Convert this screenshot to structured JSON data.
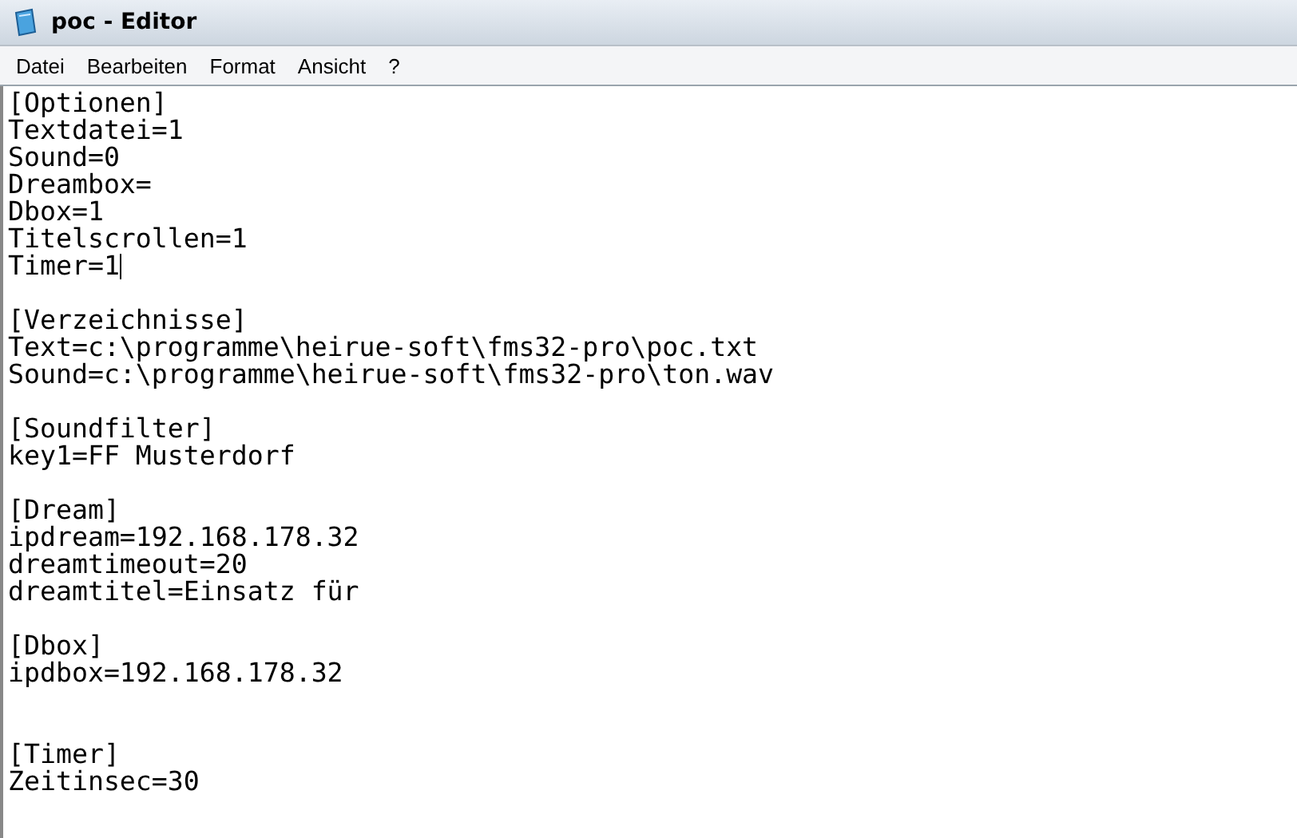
{
  "window": {
    "title": "poc - Editor"
  },
  "menu": [
    "Datei",
    "Bearbeiten",
    "Format",
    "Ansicht",
    "?"
  ],
  "lines": [
    {
      "kind": "text",
      "text": "[Optionen]",
      "caret": false
    },
    {
      "kind": "text",
      "text": "Textdatei=1",
      "caret": false
    },
    {
      "kind": "text",
      "text": "Sound=0",
      "caret": false
    },
    {
      "kind": "text",
      "text": "Dreambox=",
      "caret": false
    },
    {
      "kind": "text",
      "text": "Dbox=1",
      "caret": false
    },
    {
      "kind": "text",
      "text": "Titelscrollen=1",
      "caret": false
    },
    {
      "kind": "text",
      "text": "Timer=1",
      "caret": true
    },
    {
      "kind": "blank"
    },
    {
      "kind": "text",
      "text": "[Verzeichnisse]",
      "caret": false
    },
    {
      "kind": "text",
      "text": "Text=c:\\programme\\heirue-soft\\fms32-pro\\poc.txt",
      "caret": false
    },
    {
      "kind": "text",
      "text": "Sound=c:\\programme\\heirue-soft\\fms32-pro\\ton.wav",
      "caret": false
    },
    {
      "kind": "blank"
    },
    {
      "kind": "text",
      "text": "[Soundfilter]",
      "caret": false
    },
    {
      "kind": "text",
      "text": "key1=FF Musterdorf",
      "caret": false
    },
    {
      "kind": "blank"
    },
    {
      "kind": "text",
      "text": "[Dream]",
      "caret": false
    },
    {
      "kind": "text",
      "text": "ipdream=192.168.178.32",
      "caret": false
    },
    {
      "kind": "text",
      "text": "dreamtimeout=20",
      "caret": false
    },
    {
      "kind": "text",
      "text": "dreamtitel=Einsatz für",
      "caret": false
    },
    {
      "kind": "blank"
    },
    {
      "kind": "text",
      "text": "[Dbox]",
      "caret": false
    },
    {
      "kind": "text",
      "text": "ipdbox=192.168.178.32",
      "caret": false
    },
    {
      "kind": "blank"
    },
    {
      "kind": "blank"
    },
    {
      "kind": "text",
      "text": "[Timer]",
      "caret": false
    },
    {
      "kind": "text",
      "text": "Zeitinsec=30",
      "caret": false
    }
  ]
}
